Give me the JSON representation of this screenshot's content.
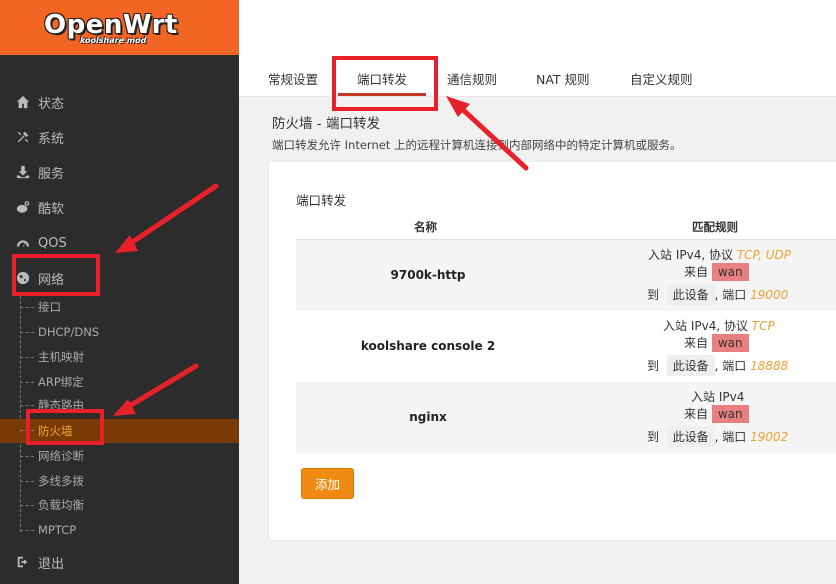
{
  "logo": {
    "main": "OpenWrt",
    "sub": "koolshare mod"
  },
  "sidebar": {
    "top_items": [
      {
        "label": "状态",
        "icon": "home-icon"
      },
      {
        "label": "系统",
        "icon": "wrench-icon"
      },
      {
        "label": "服务",
        "icon": "download-icon"
      },
      {
        "label": "酷软",
        "icon": "weibo-icon"
      },
      {
        "label": "QOS",
        "icon": "gauge-icon"
      },
      {
        "label": "网络",
        "icon": "globe-icon"
      }
    ],
    "network_sub_items": [
      {
        "label": "接口"
      },
      {
        "label": "DHCP/DNS"
      },
      {
        "label": "主机映射"
      },
      {
        "label": "ARP绑定"
      },
      {
        "label": "静态路由"
      },
      {
        "label": "防火墙"
      },
      {
        "label": "网络诊断"
      },
      {
        "label": "多线多拨"
      },
      {
        "label": "负载均衡"
      },
      {
        "label": "MPTCP"
      }
    ],
    "logout": {
      "label": "退出",
      "icon": "logout-icon"
    }
  },
  "tabs": [
    {
      "label": "常规设置"
    },
    {
      "label": "端口转发"
    },
    {
      "label": "通信规则"
    },
    {
      "label": "NAT 规则"
    },
    {
      "label": "自定义规则"
    }
  ],
  "active_tab": "端口转发",
  "page": {
    "title": "防火墙 - 端口转发",
    "description": "端口转发允许 Internet 上的远程计算机连接到内部网络中的特定计算机或服务。"
  },
  "section": {
    "title": "端口转发",
    "columns": {
      "name": "名称",
      "match": "匹配规则"
    },
    "rows": [
      {
        "name": "9700k-http",
        "line1_prefix": "入站 IPv4, 协议 ",
        "protocols": "TCP, UDP",
        "from_label": "来自",
        "from_zone": "wan",
        "to_label": "到",
        "device": "此设备",
        "port_label": ", 端口",
        "port": "19000"
      },
      {
        "name": "koolshare console 2",
        "line1_prefix": "入站 IPv4, 协议 ",
        "protocols": "TCP",
        "from_label": "来自",
        "from_zone": "wan",
        "to_label": "到",
        "device": "此设备",
        "port_label": ", 端口",
        "port": "18888"
      },
      {
        "name": "nginx",
        "line1_prefix": "入站 IPv4",
        "protocols": "",
        "from_label": "来自",
        "from_zone": "wan",
        "to_label": "到",
        "device": "此设备",
        "port_label": ", 端口",
        "port": "19002"
      }
    ],
    "add_button": "添加"
  },
  "colors": {
    "brand_orange": "#f26522",
    "sidebar_bg": "#2c2c2c",
    "active_menu_bg": "#7a3a05",
    "active_menu_text": "#f5a623",
    "add_button": "#f08a12",
    "wan_badge": "#e88080",
    "annotation_red": "#e8202a"
  }
}
